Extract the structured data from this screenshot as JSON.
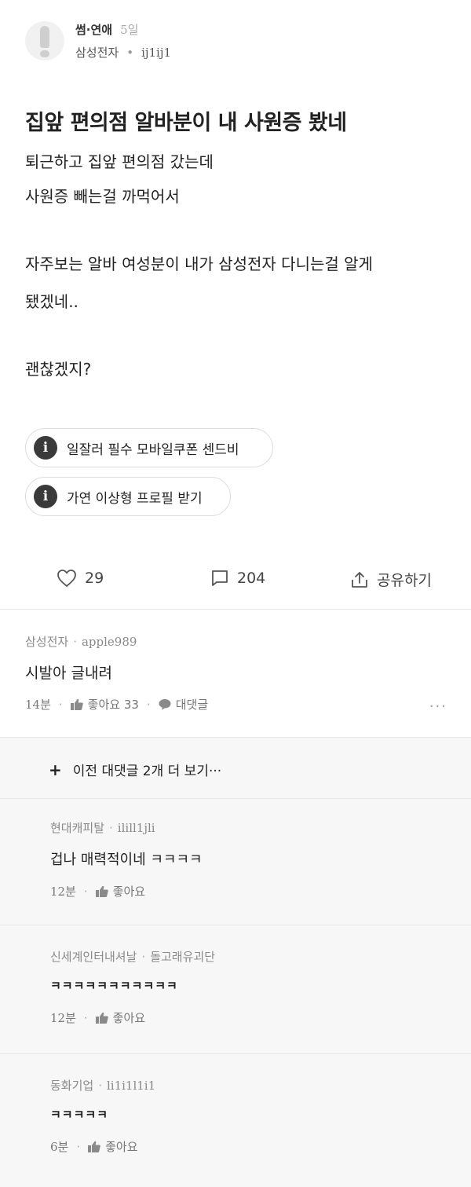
{
  "post": {
    "category": "썸·연애",
    "age": "5일",
    "company": "삼성전자",
    "separator": "•",
    "nickname": "ij1ij1",
    "title": "집앞 편의점 알바분이 내 사원증 봤네",
    "body_lines": [
      "퇴근하고 집앞 편의점 갔는데",
      "사원증 빼는걸 까먹어서",
      "자주보는 알바 여성분이 내가 삼성전자 다니는걸 알게",
      "됐겠네..",
      "괜찮겠지?"
    ]
  },
  "ads": [
    {
      "label": "일잘러 필수 모바일쿠폰 센드비",
      "icon": "info-icon"
    },
    {
      "label": "가연 이상형 프로필 받기",
      "icon": "info-icon"
    }
  ],
  "actions": {
    "like_count": "29",
    "comment_count": "204",
    "share_label": "공유하기"
  },
  "top_comment": {
    "company": "삼성전자",
    "nickname": "apple989",
    "text": "시발아 글내려",
    "time": "14분",
    "like_label": "좋아요 33",
    "reply_label": "대댓글",
    "more": "..."
  },
  "more_replies_label": "이전 대댓글 2개 더 보기···",
  "replies": [
    {
      "company": "현대캐피탈",
      "nickname": "ilill1jli",
      "text": "겁나 매력적이네 ㅋㅋㅋㅋ",
      "time": "12분",
      "like_label": "좋아요"
    },
    {
      "company": "신세계인터내셔날",
      "nickname": "돌고래유괴단",
      "text": "ㅋㅋㅋㅋㅋㅋㅋㅋㅋㅋㅋ",
      "time": "12분",
      "like_label": "좋아요"
    },
    {
      "company": "동화기업",
      "nickname": "li1i1l1i1",
      "text": "ㅋㅋㅋㅋㅋ",
      "time": "6분",
      "like_label": "좋아요"
    }
  ]
}
